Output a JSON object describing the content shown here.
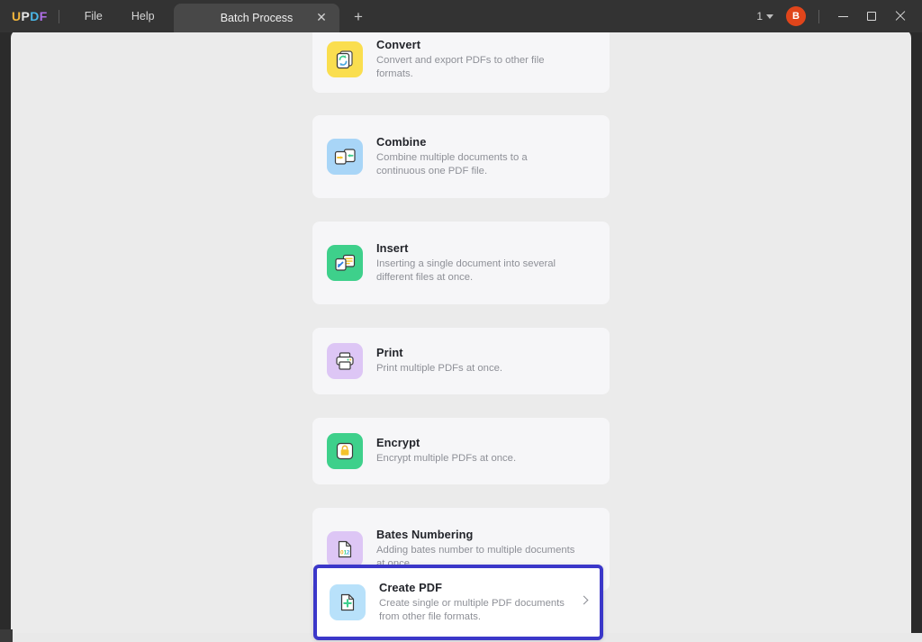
{
  "titlebar": {
    "logo": {
      "part1": "UP",
      "part2": "D",
      "part3": "F",
      "full": "UPDF"
    },
    "menus": [
      {
        "label": "File",
        "name": "menu-file"
      },
      {
        "label": "Help",
        "name": "menu-help"
      }
    ],
    "tab": {
      "label": "Batch Process",
      "close_glyph": "✕"
    },
    "new_tab_glyph": "+",
    "page_count": "1",
    "avatar_initial": "B",
    "window_controls": {
      "minimize": "minimize",
      "maximize": "maximize",
      "close": "close"
    }
  },
  "main": {
    "cards": [
      {
        "id": "convert",
        "title": "Convert",
        "desc": "Convert and export PDFs to other file formats.",
        "icon": "convert-icon",
        "icon_bg": "#fade4f"
      },
      {
        "id": "combine",
        "title": "Combine",
        "desc": "Combine multiple documents to a continuous one PDF file.",
        "icon": "combine-icon",
        "icon_bg": "#a8d5f7"
      },
      {
        "id": "insert",
        "title": "Insert",
        "desc": "Inserting a single document into several different files at once.",
        "icon": "insert-icon",
        "icon_bg": "#3ed08b"
      },
      {
        "id": "print",
        "title": "Print",
        "desc": "Print multiple PDFs at once.",
        "icon": "print-icon",
        "icon_bg": "#ddc6f5"
      },
      {
        "id": "encrypt",
        "title": "Encrypt",
        "desc": "Encrypt multiple PDFs at once.",
        "icon": "encrypt-icon",
        "icon_bg": "#3ed08b"
      },
      {
        "id": "bates-numbering",
        "title": "Bates Numbering",
        "desc": "Adding bates number to multiple documents at once.",
        "icon": "bates-numbering-icon",
        "icon_bg": "#ddc6f5",
        "icon_text": "012"
      },
      {
        "id": "create-pdf",
        "title": "Create PDF",
        "desc": "Create single or multiple PDF documents from other file formats.",
        "icon": "create-pdf-icon",
        "icon_bg": "#b8e1fa",
        "selected": true,
        "chevron": "chevron-right-icon"
      }
    ]
  },
  "colors": {
    "highlight_border": "#3b37c9",
    "window_bg": "#ebebeb",
    "card_bg": "#f6f6f8",
    "titlebar_bg": "#333333",
    "avatar_bg": "#e0451b"
  }
}
